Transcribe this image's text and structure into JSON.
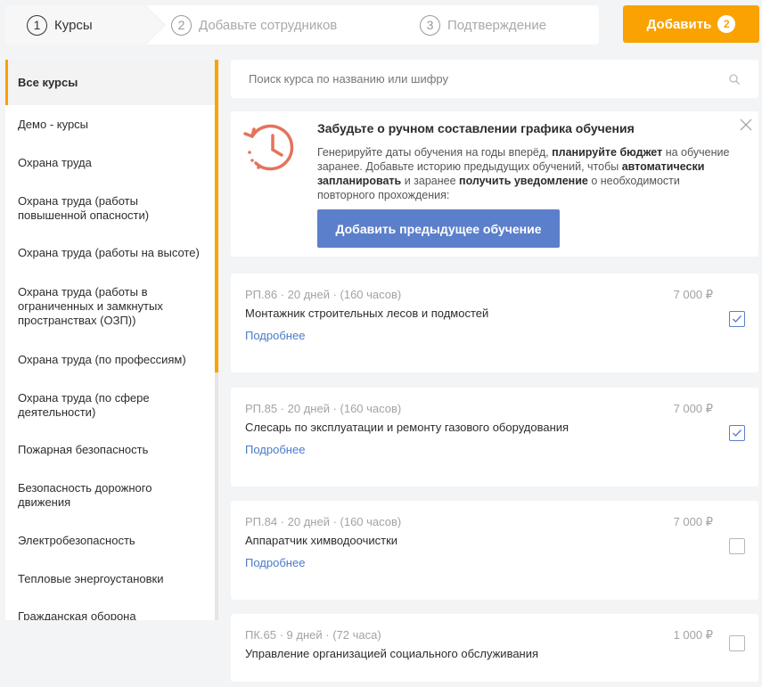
{
  "stepper": {
    "steps": [
      {
        "num": "1",
        "label": "Курсы"
      },
      {
        "num": "2",
        "label": "Добавьте сотрудников"
      },
      {
        "num": "3",
        "label": "Подтверждение"
      }
    ],
    "add_label": "Добавить",
    "add_count": "2"
  },
  "sidebar": {
    "items": [
      {
        "label": "Все курсы",
        "active": true
      },
      {
        "label": "Демо - курсы"
      },
      {
        "label": "Охрана труда"
      },
      {
        "label": "Охрана труда (работы повышенной опасности)"
      },
      {
        "label": "Охрана труда (работы на высоте)"
      },
      {
        "label": "Охрана труда (работы в ограниченных и замкнутых пространствах (ОЗП))"
      },
      {
        "label": "Охрана труда (по профессиям)"
      },
      {
        "label": "Охрана труда (по сфере деятельности)"
      },
      {
        "label": "Пожарная безопасность"
      },
      {
        "label": "Безопасность дорожного движения"
      },
      {
        "label": "Электробезопасность"
      },
      {
        "label": "Тепловые энергоустановки"
      },
      {
        "label": "Гражданская оборона"
      }
    ]
  },
  "search": {
    "placeholder": "Поиск курса по названию или шифру",
    "value": ""
  },
  "banner": {
    "title": "Забудьте о ручном составлении графика обучения",
    "text_parts": {
      "p1": "Генерируйте даты обучения на годы вперёд, ",
      "b1": "планируйте бюджет",
      "p2": " на обучение заранее. Добавьте историю предыдущих обучений, чтобы ",
      "b2": "автоматически запланировать",
      "p3": " и заранее ",
      "b3": "получить уведомление",
      "p4": " о необходимости повторного прохождения:"
    },
    "button_label": "Добавить предыдущее обучение"
  },
  "courses": [
    {
      "meta": "РП.86 · 20 дней · (160 часов)",
      "price": "7 000 ₽",
      "name": "Монтажник строительных лесов и подмостей",
      "more": "Подробнее",
      "checked": true
    },
    {
      "meta": "РП.85 · 20 дней · (160 часов)",
      "price": "7 000 ₽",
      "name": "Слесарь по эксплуатации и ремонту газового оборудования",
      "more": "Подробнее",
      "checked": true
    },
    {
      "meta": "РП.84 · 20 дней · (160 часов)",
      "price": "7 000 ₽",
      "name": "Аппаратчик химводоочистки",
      "more": "Подробнее",
      "checked": false
    },
    {
      "meta": "ПК.65 · 9 дней · (72 часа)",
      "price": "1 000 ₽",
      "name": "Управление организацией социального обслуживания",
      "more": "",
      "checked": false
    }
  ],
  "colors": {
    "accent": "#f9a201",
    "primary": "#5b7fcb",
    "link": "#4a7bc8",
    "banner_icon": "#e5735a"
  }
}
